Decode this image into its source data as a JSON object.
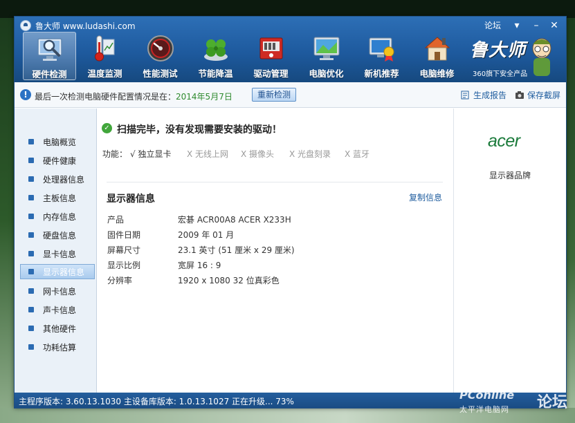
{
  "app": {
    "title": "鲁大师 www.ludashi.com",
    "forum_link": "论坛",
    "brand_name": "鲁大师",
    "brand_sub": "360旗下安全产品"
  },
  "nav": {
    "items": [
      {
        "label": "硬件检测",
        "icon": "magnifier-monitor-icon",
        "active": true
      },
      {
        "label": "温度监测",
        "icon": "thermometer-icon",
        "active": false
      },
      {
        "label": "性能测试",
        "icon": "speedometer-icon",
        "active": false
      },
      {
        "label": "节能降温",
        "icon": "clover-leaf-icon",
        "active": false
      },
      {
        "label": "驱动管理",
        "icon": "driver-chip-icon",
        "active": false
      },
      {
        "label": "电脑优化",
        "icon": "optimize-monitor-icon",
        "active": false
      },
      {
        "label": "新机推荐",
        "icon": "award-monitor-icon",
        "active": false
      },
      {
        "label": "电脑维修",
        "icon": "repair-house-icon",
        "active": false
      }
    ]
  },
  "infobar": {
    "text": "最后一次检测电脑硬件配置情况是在：",
    "date": "2014年5月7日",
    "recheck": "重新检测",
    "report": "生成报告",
    "screenshot": "保存截屏"
  },
  "sidebar": {
    "items": [
      {
        "label": "电脑概览"
      },
      {
        "label": "硬件健康"
      },
      {
        "label": "处理器信息"
      },
      {
        "label": "主板信息"
      },
      {
        "label": "内存信息"
      },
      {
        "label": "硬盘信息"
      },
      {
        "label": "显卡信息"
      },
      {
        "label": "显示器信息"
      },
      {
        "label": "网卡信息"
      },
      {
        "label": "声卡信息"
      },
      {
        "label": "其他硬件"
      },
      {
        "label": "功耗估算"
      }
    ],
    "active_index": 7
  },
  "main": {
    "scan_msg": "扫描完毕，没有发现需要安装的驱动！",
    "features_label": "功能：",
    "features": [
      {
        "label": "√ 独立显卡",
        "enabled": true
      },
      {
        "label": "X 无线上网",
        "enabled": false
      },
      {
        "label": "X 摄像头",
        "enabled": false
      },
      {
        "label": "X 光盘刻录",
        "enabled": false
      },
      {
        "label": "X 蓝牙",
        "enabled": false
      }
    ],
    "section_title": "显示器信息",
    "copy_link": "复制信息",
    "rows": [
      {
        "key": "产品",
        "value": "宏碁 ACR00A8 ACER X233H"
      },
      {
        "key": "固件日期",
        "value": "2009 年 01 月"
      },
      {
        "key": "屏幕尺寸",
        "value": "23.1 英寸 (51 厘米 x 29 厘米)"
      },
      {
        "key": "显示比例",
        "value": "宽屏 16 : 9"
      },
      {
        "key": "分辨率",
        "value": "1920 x 1080 32 位真彩色"
      }
    ]
  },
  "rightpanel": {
    "logo": "acer",
    "caption": "显示器品牌"
  },
  "status": {
    "text": "主程序版本: 3.60.13.1030  主设备库版本: 1.0.13.1027   正在升级... 73%",
    "upgrade_progress_percent": 73
  },
  "watermark": {
    "pc": "PConline",
    "sub": "太平洋电脑网",
    "forum": "论坛"
  },
  "colors": {
    "header_blue": "#1e5a9e",
    "accent_green": "#2e8a2e",
    "link_blue": "#1e5c9e",
    "acer_green": "#1a7a3a"
  }
}
